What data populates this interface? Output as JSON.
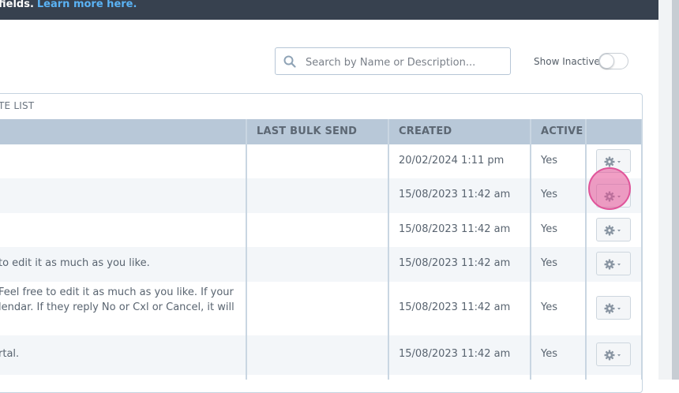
{
  "banner": {
    "text": "fields.",
    "link": "Learn more here."
  },
  "search": {
    "placeholder": "Search by Name or Description..."
  },
  "filters": {
    "show_inactive_label": "Show Inactive",
    "show_inactive": false
  },
  "panel": {
    "title": "TE LIST"
  },
  "table": {
    "columns": {
      "last_bulk_send": "LAST BULK SEND",
      "created": "CREATED",
      "active": "ACTIVE"
    },
    "rows": [
      {
        "desc": "",
        "desc2": "",
        "last_bulk_send": "",
        "created": "20/02/2024 1:11 pm",
        "active": "Yes"
      },
      {
        "desc": "",
        "desc2": "",
        "last_bulk_send": "",
        "created": "15/08/2023 11:42 am",
        "active": "Yes"
      },
      {
        "desc": "",
        "desc2": "",
        "last_bulk_send": "",
        "created": "15/08/2023 11:42 am",
        "active": "Yes"
      },
      {
        "desc": "to edit it as much as you like.",
        "desc2": "",
        "last_bulk_send": "",
        "created": "15/08/2023 11:42 am",
        "active": "Yes"
      },
      {
        "desc": "Feel free to edit it as much as you like. If your",
        "desc2": "lendar. If they reply No or Cxl or Cancel, it will",
        "last_bulk_send": "",
        "created": "15/08/2023 11:42 am",
        "active": "Yes"
      },
      {
        "desc": "rtal.",
        "desc2": "",
        "last_bulk_send": "",
        "created": "15/08/2023 11:42 am",
        "active": "Yes"
      }
    ]
  },
  "colors": {
    "banner_bg": "#37414f",
    "link": "#5bb3f5",
    "header_bg": "#b8c8d8",
    "alt_row": "#f3f6f9",
    "cursor": "#e0559a"
  },
  "icons": [
    "search-icon",
    "gear-icon",
    "caret-down-icon"
  ]
}
